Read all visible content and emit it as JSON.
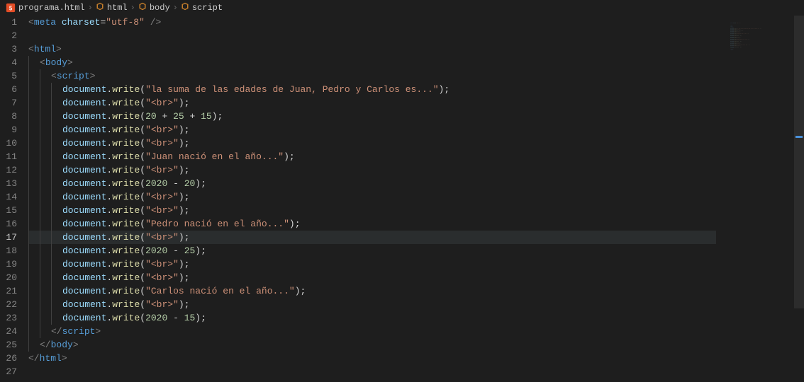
{
  "breadcrumb": {
    "file": "programa.html",
    "path": [
      "html",
      "body",
      "script"
    ],
    "sep": "›"
  },
  "editor": {
    "activeLine": 17,
    "lines": [
      {
        "n": 1,
        "indent": 0,
        "tokens": [
          {
            "t": "bracket",
            "v": "<"
          },
          {
            "t": "tag",
            "v": "meta"
          },
          {
            "t": "plain",
            "v": " "
          },
          {
            "t": "attr",
            "v": "charset"
          },
          {
            "t": "op",
            "v": "="
          },
          {
            "t": "string",
            "v": "\"utf-8\""
          },
          {
            "t": "plain",
            "v": " "
          },
          {
            "t": "bracket",
            "v": "/>"
          }
        ]
      },
      {
        "n": 2,
        "indent": 0,
        "tokens": []
      },
      {
        "n": 3,
        "indent": 0,
        "tokens": [
          {
            "t": "bracket",
            "v": "<"
          },
          {
            "t": "tag",
            "v": "html"
          },
          {
            "t": "bracket",
            "v": ">"
          }
        ]
      },
      {
        "n": 4,
        "indent": 1,
        "tokens": [
          {
            "t": "bracket",
            "v": "<"
          },
          {
            "t": "tag",
            "v": "body"
          },
          {
            "t": "bracket",
            "v": ">"
          }
        ]
      },
      {
        "n": 5,
        "indent": 2,
        "tokens": [
          {
            "t": "bracket",
            "v": "<"
          },
          {
            "t": "tag",
            "v": "script"
          },
          {
            "t": "bracket",
            "v": ">"
          }
        ]
      },
      {
        "n": 6,
        "indent": 3,
        "tokens": [
          {
            "t": "var",
            "v": "document"
          },
          {
            "t": "punc",
            "v": "."
          },
          {
            "t": "func",
            "v": "write"
          },
          {
            "t": "punc",
            "v": "("
          },
          {
            "t": "string",
            "v": "\"la suma de las edades de Juan, Pedro y Carlos es...\""
          },
          {
            "t": "punc",
            "v": ");"
          }
        ]
      },
      {
        "n": 7,
        "indent": 3,
        "tokens": [
          {
            "t": "var",
            "v": "document"
          },
          {
            "t": "punc",
            "v": "."
          },
          {
            "t": "func",
            "v": "write"
          },
          {
            "t": "punc",
            "v": "("
          },
          {
            "t": "string",
            "v": "\"<br>\""
          },
          {
            "t": "punc",
            "v": ");"
          }
        ]
      },
      {
        "n": 8,
        "indent": 3,
        "tokens": [
          {
            "t": "var",
            "v": "document"
          },
          {
            "t": "punc",
            "v": "."
          },
          {
            "t": "func",
            "v": "write"
          },
          {
            "t": "punc",
            "v": "("
          },
          {
            "t": "num",
            "v": "20"
          },
          {
            "t": "punc",
            "v": " + "
          },
          {
            "t": "num",
            "v": "25"
          },
          {
            "t": "punc",
            "v": " + "
          },
          {
            "t": "num",
            "v": "15"
          },
          {
            "t": "punc",
            "v": ");"
          }
        ]
      },
      {
        "n": 9,
        "indent": 3,
        "tokens": [
          {
            "t": "var",
            "v": "document"
          },
          {
            "t": "punc",
            "v": "."
          },
          {
            "t": "func",
            "v": "write"
          },
          {
            "t": "punc",
            "v": "("
          },
          {
            "t": "string",
            "v": "\"<br>\""
          },
          {
            "t": "punc",
            "v": ");"
          }
        ]
      },
      {
        "n": 10,
        "indent": 3,
        "tokens": [
          {
            "t": "var",
            "v": "document"
          },
          {
            "t": "punc",
            "v": "."
          },
          {
            "t": "func",
            "v": "write"
          },
          {
            "t": "punc",
            "v": "("
          },
          {
            "t": "string",
            "v": "\"<br>\""
          },
          {
            "t": "punc",
            "v": ");"
          }
        ]
      },
      {
        "n": 11,
        "indent": 3,
        "tokens": [
          {
            "t": "var",
            "v": "document"
          },
          {
            "t": "punc",
            "v": "."
          },
          {
            "t": "func",
            "v": "write"
          },
          {
            "t": "punc",
            "v": "("
          },
          {
            "t": "string",
            "v": "\"Juan nació en el año...\""
          },
          {
            "t": "punc",
            "v": ");"
          }
        ]
      },
      {
        "n": 12,
        "indent": 3,
        "tokens": [
          {
            "t": "var",
            "v": "document"
          },
          {
            "t": "punc",
            "v": "."
          },
          {
            "t": "func",
            "v": "write"
          },
          {
            "t": "punc",
            "v": "("
          },
          {
            "t": "string",
            "v": "\"<br>\""
          },
          {
            "t": "punc",
            "v": ");"
          }
        ]
      },
      {
        "n": 13,
        "indent": 3,
        "tokens": [
          {
            "t": "var",
            "v": "document"
          },
          {
            "t": "punc",
            "v": "."
          },
          {
            "t": "func",
            "v": "write"
          },
          {
            "t": "punc",
            "v": "("
          },
          {
            "t": "num",
            "v": "2020"
          },
          {
            "t": "punc",
            "v": " - "
          },
          {
            "t": "num",
            "v": "20"
          },
          {
            "t": "punc",
            "v": ");"
          }
        ]
      },
      {
        "n": 14,
        "indent": 3,
        "tokens": [
          {
            "t": "var",
            "v": "document"
          },
          {
            "t": "punc",
            "v": "."
          },
          {
            "t": "func",
            "v": "write"
          },
          {
            "t": "punc",
            "v": "("
          },
          {
            "t": "string",
            "v": "\"<br>\""
          },
          {
            "t": "punc",
            "v": ");"
          }
        ]
      },
      {
        "n": 15,
        "indent": 3,
        "tokens": [
          {
            "t": "var",
            "v": "document"
          },
          {
            "t": "punc",
            "v": "."
          },
          {
            "t": "func",
            "v": "write"
          },
          {
            "t": "punc",
            "v": "("
          },
          {
            "t": "string",
            "v": "\"<br>\""
          },
          {
            "t": "punc",
            "v": ");"
          }
        ]
      },
      {
        "n": 16,
        "indent": 3,
        "tokens": [
          {
            "t": "var",
            "v": "document"
          },
          {
            "t": "punc",
            "v": "."
          },
          {
            "t": "func",
            "v": "write"
          },
          {
            "t": "punc",
            "v": "("
          },
          {
            "t": "string",
            "v": "\"Pedro nació en el año...\""
          },
          {
            "t": "punc",
            "v": ");"
          }
        ]
      },
      {
        "n": 17,
        "indent": 3,
        "tokens": [
          {
            "t": "var",
            "v": "document"
          },
          {
            "t": "punc",
            "v": "."
          },
          {
            "t": "func",
            "v": "write"
          },
          {
            "t": "punc",
            "v": "("
          },
          {
            "t": "string",
            "v": "\"<br>\""
          },
          {
            "t": "punc",
            "v": ");"
          }
        ]
      },
      {
        "n": 18,
        "indent": 3,
        "tokens": [
          {
            "t": "var",
            "v": "document"
          },
          {
            "t": "punc",
            "v": "."
          },
          {
            "t": "func",
            "v": "write"
          },
          {
            "t": "punc",
            "v": "("
          },
          {
            "t": "num",
            "v": "2020"
          },
          {
            "t": "punc",
            "v": " - "
          },
          {
            "t": "num",
            "v": "25"
          },
          {
            "t": "punc",
            "v": ");"
          }
        ]
      },
      {
        "n": 19,
        "indent": 3,
        "tokens": [
          {
            "t": "var",
            "v": "document"
          },
          {
            "t": "punc",
            "v": "."
          },
          {
            "t": "func",
            "v": "write"
          },
          {
            "t": "punc",
            "v": "("
          },
          {
            "t": "string",
            "v": "\"<br>\""
          },
          {
            "t": "punc",
            "v": ");"
          }
        ]
      },
      {
        "n": 20,
        "indent": 3,
        "tokens": [
          {
            "t": "var",
            "v": "document"
          },
          {
            "t": "punc",
            "v": "."
          },
          {
            "t": "func",
            "v": "write"
          },
          {
            "t": "punc",
            "v": "("
          },
          {
            "t": "string",
            "v": "\"<br>\""
          },
          {
            "t": "punc",
            "v": ");"
          }
        ]
      },
      {
        "n": 21,
        "indent": 3,
        "tokens": [
          {
            "t": "var",
            "v": "document"
          },
          {
            "t": "punc",
            "v": "."
          },
          {
            "t": "func",
            "v": "write"
          },
          {
            "t": "punc",
            "v": "("
          },
          {
            "t": "string",
            "v": "\"Carlos nació en el año...\""
          },
          {
            "t": "punc",
            "v": ");"
          }
        ]
      },
      {
        "n": 22,
        "indent": 3,
        "tokens": [
          {
            "t": "var",
            "v": "document"
          },
          {
            "t": "punc",
            "v": "."
          },
          {
            "t": "func",
            "v": "write"
          },
          {
            "t": "punc",
            "v": "("
          },
          {
            "t": "string",
            "v": "\"<br>\""
          },
          {
            "t": "punc",
            "v": ");"
          }
        ]
      },
      {
        "n": 23,
        "indent": 3,
        "tokens": [
          {
            "t": "var",
            "v": "document"
          },
          {
            "t": "punc",
            "v": "."
          },
          {
            "t": "func",
            "v": "write"
          },
          {
            "t": "punc",
            "v": "("
          },
          {
            "t": "num",
            "v": "2020"
          },
          {
            "t": "punc",
            "v": " - "
          },
          {
            "t": "num",
            "v": "15"
          },
          {
            "t": "punc",
            "v": ");"
          }
        ]
      },
      {
        "n": 24,
        "indent": 2,
        "tokens": [
          {
            "t": "bracket",
            "v": "</"
          },
          {
            "t": "tag",
            "v": "script"
          },
          {
            "t": "bracket",
            "v": ">"
          }
        ]
      },
      {
        "n": 25,
        "indent": 1,
        "tokens": [
          {
            "t": "bracket",
            "v": "</"
          },
          {
            "t": "tag",
            "v": "body"
          },
          {
            "t": "bracket",
            "v": ">"
          }
        ]
      },
      {
        "n": 26,
        "indent": 0,
        "tokens": [
          {
            "t": "bracket",
            "v": "</"
          },
          {
            "t": "tag",
            "v": "html"
          },
          {
            "t": "bracket",
            "v": ">"
          }
        ]
      },
      {
        "n": 27,
        "indent": 0,
        "tokens": []
      }
    ]
  }
}
